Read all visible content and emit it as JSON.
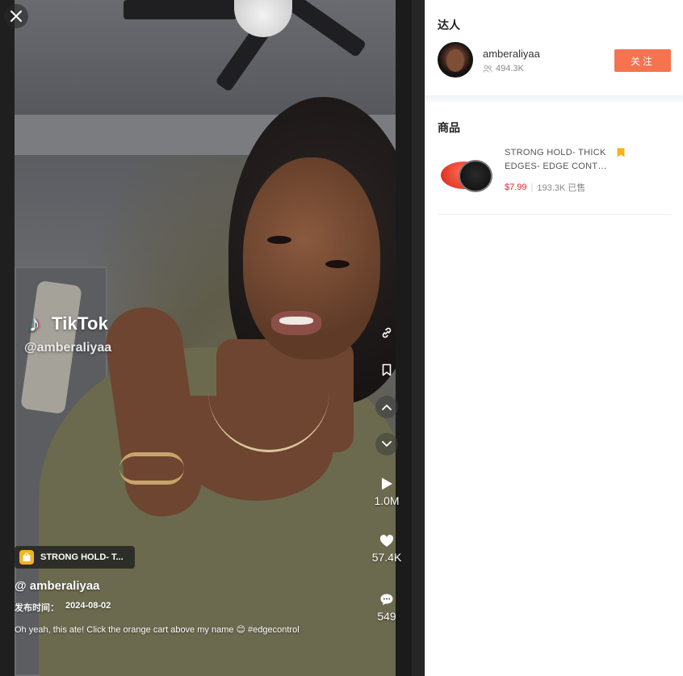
{
  "video": {
    "watermark_brand": "TikTok",
    "watermark_handle": "@amberaliyaa",
    "product_pill_label": "STRONG HOLD- T...",
    "author": "@ amberaliyaa",
    "publish_label": "发布时间：",
    "publish_date": "2024-08-02",
    "caption_text": "Oh yeah, this ate! Click the orange cart above my name 😊 #edgecontrol",
    "stats": {
      "plays": "1.0M",
      "likes": "57.4K",
      "comments": "549"
    }
  },
  "panel": {
    "influencer_section_title": "达人",
    "influencer": {
      "name": "amberaliyaa",
      "followers": "494.3K",
      "follow_label": "关注"
    },
    "products_section_title": "商品",
    "product": {
      "title_line1": "STRONG HOLD- THICK",
      "title_line2": "EDGES- EDGE CONTR...",
      "price": "$7.99",
      "sold": "193.3K 已售"
    }
  },
  "colors": {
    "follow_button": "#f5734f",
    "price": "#e2242c",
    "bookmark": "#f5b21a",
    "product_bag": "#f2b51c"
  },
  "icons": [
    "close-icon",
    "link-icon",
    "bookmark-icon",
    "chevron-up-icon",
    "chevron-down-icon",
    "play-icon",
    "heart-icon",
    "comment-icon",
    "shopping-bag-icon",
    "followers-icon"
  ]
}
